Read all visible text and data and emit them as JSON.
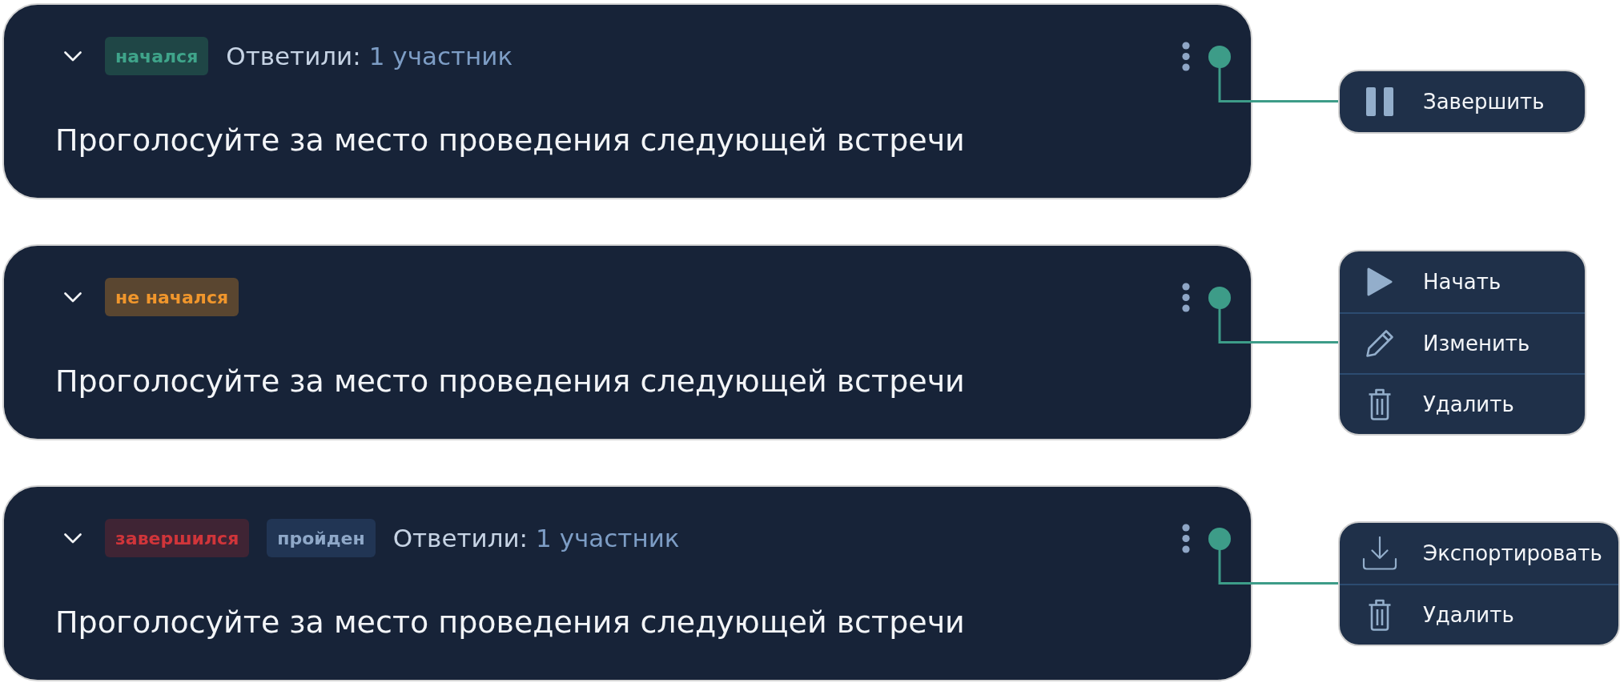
{
  "polls": [
    {
      "badges": [
        {
          "text": "начался",
          "kind": "started"
        }
      ],
      "responses": {
        "label": "Ответили:",
        "count": "1 участник"
      },
      "title": "Проголосуйте за место проведения следующей встречи",
      "menu": {
        "items": [
          {
            "kind": "pause",
            "label": "Завершить"
          }
        ]
      }
    },
    {
      "badges": [
        {
          "text": "не начался",
          "kind": "pending"
        }
      ],
      "title": "Проголосуйте за место проведения следующей встречи",
      "menu": {
        "items": [
          {
            "kind": "play",
            "label": "Начать"
          },
          {
            "kind": "edit",
            "label": "Изменить"
          },
          {
            "kind": "delete",
            "label": "Удалить"
          }
        ]
      }
    },
    {
      "badges": [
        {
          "text": "завершился",
          "kind": "finished"
        },
        {
          "text": "пройден",
          "kind": "passed"
        }
      ],
      "responses": {
        "label": "Ответили:",
        "count": "1 участник"
      },
      "title": "Проголосуйте за место проведения следующей встречи",
      "menu": {
        "items": [
          {
            "kind": "export",
            "label": "Экспортировать"
          },
          {
            "kind": "delete",
            "label": "Удалить"
          }
        ]
      }
    }
  ]
}
